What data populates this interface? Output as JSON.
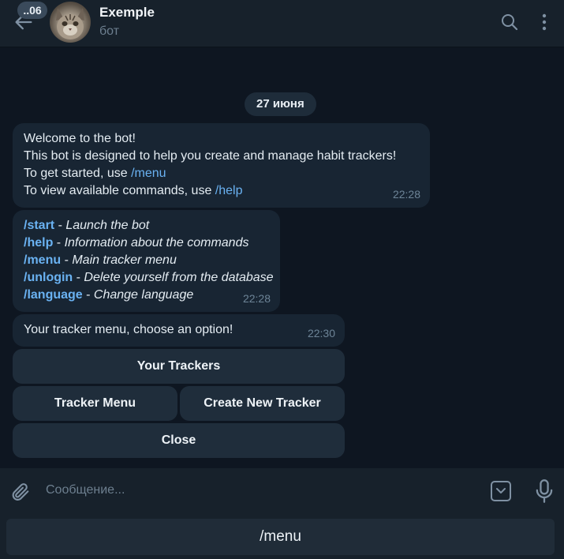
{
  "header": {
    "unread_count": "..06",
    "title": "Exemple",
    "subtitle": "бот"
  },
  "date_chip": "27 июня",
  "messages": {
    "welcome": {
      "line1": "Welcome to the bot!",
      "line2": "This bot is designed to help you create and manage habit trackers!",
      "line3_prefix": "To get started, use ",
      "line3_link": "/menu",
      "line4_prefix": "To view available commands, use ",
      "line4_link": "/help",
      "time": "22:28"
    },
    "commands": {
      "items": [
        {
          "cmd": "/start",
          "desc": "Launch the bot"
        },
        {
          "cmd": "/help",
          "desc": "Information about the commands"
        },
        {
          "cmd": "/menu",
          "desc": "Main tracker menu"
        },
        {
          "cmd": "/unlogin",
          "desc": "Delete yourself from the database"
        },
        {
          "cmd": "/language",
          "desc": "Change language"
        }
      ],
      "separator": " - ",
      "time": "22:28"
    },
    "menu_prompt": {
      "text": "Your tracker menu, choose an option!",
      "time": "22:30"
    }
  },
  "inline_keyboard": {
    "your_trackers": "Your Trackers",
    "tracker_menu": "Tracker Menu",
    "create_new_tracker": "Create New Tracker",
    "close": "Close"
  },
  "composer": {
    "placeholder": "Сообщение...",
    "value": ""
  },
  "reply_keyboard": {
    "menu_button": "/menu"
  },
  "colors": {
    "background": "#0e1621",
    "header": "#17212b",
    "bubble": "#182533",
    "link": "#6ab2f2",
    "muted": "#6d7f8f"
  },
  "icons": [
    "back-arrow-icon",
    "search-icon",
    "more-vertical-icon",
    "paperclip-icon",
    "keyboard-toggle-icon",
    "microphone-icon"
  ]
}
